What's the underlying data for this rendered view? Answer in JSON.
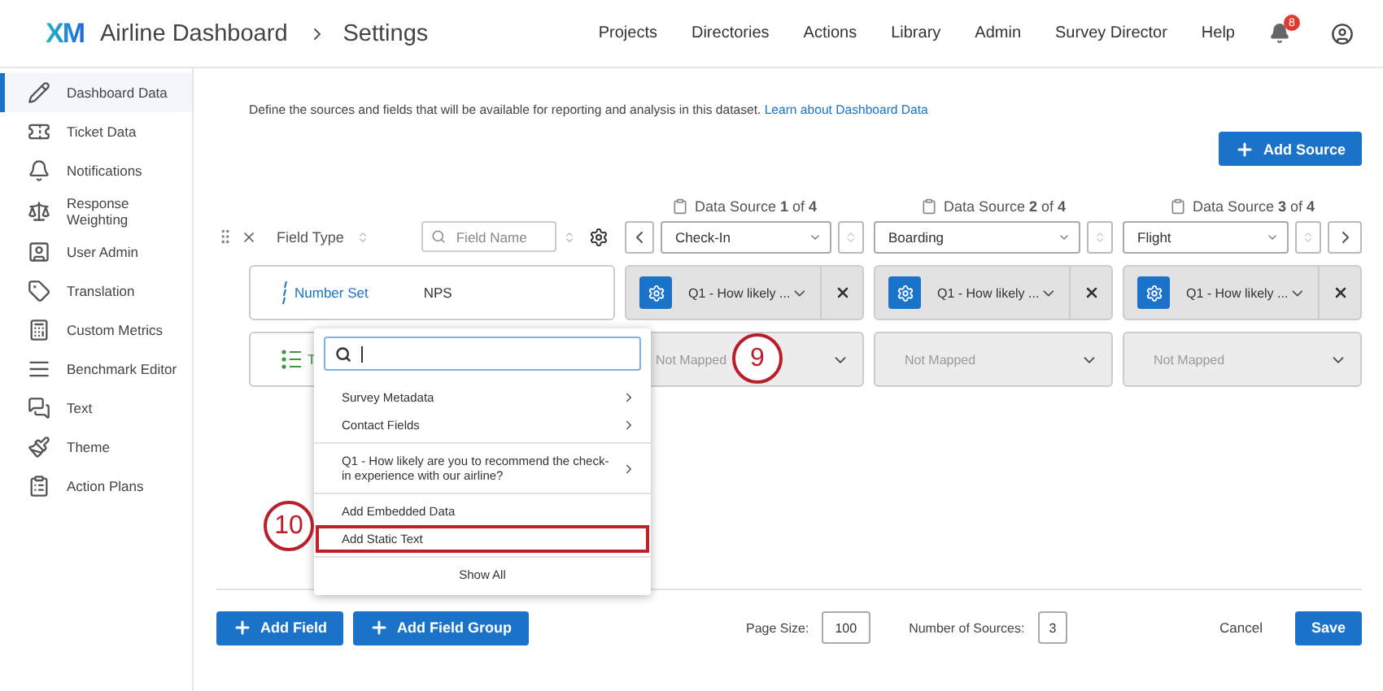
{
  "header": {
    "logo": "XM",
    "title": "Airline Dashboard",
    "breadcrumb": "Settings",
    "nav": [
      "Projects",
      "Directories",
      "Actions",
      "Library",
      "Admin",
      "Survey Director",
      "Help"
    ],
    "notification_count": "8"
  },
  "sidebar": {
    "items": [
      {
        "label": "Dashboard Data",
        "selected": true
      },
      {
        "label": "Ticket Data",
        "selected": false
      },
      {
        "label": "Notifications",
        "selected": false
      },
      {
        "label": "Response Weighting",
        "selected": false
      },
      {
        "label": "User Admin",
        "selected": false
      },
      {
        "label": "Translation",
        "selected": false
      },
      {
        "label": "Custom Metrics",
        "selected": false
      },
      {
        "label": "Benchmark Editor",
        "selected": false
      },
      {
        "label": "Text",
        "selected": false
      },
      {
        "label": "Theme",
        "selected": false
      },
      {
        "label": "Action Plans",
        "selected": false
      }
    ]
  },
  "description": {
    "text": "Define the sources and fields that will be available for reporting and analysis in this dataset.",
    "link": "Learn about Dashboard Data"
  },
  "add_source": "Add Source",
  "field_header": {
    "field_type": "Field Type",
    "field_name_placeholder": "Field Name"
  },
  "sources": [
    {
      "title": "Data Source **1** of **4**",
      "value": "Check-In"
    },
    {
      "title": "Data Source **2** of **4**",
      "value": "Boarding"
    },
    {
      "title": "Data Source **3** of **4**",
      "value": "Flight"
    }
  ],
  "fields": [
    {
      "kind": "number",
      "type_label": "Number Set",
      "name": "NPS",
      "mappings": [
        {
          "kind": "mapped",
          "text": "Q1 - How likely ..."
        },
        {
          "kind": "mapped",
          "text": "Q1 - How likely ..."
        },
        {
          "kind": "mapped",
          "text": "Q1 - How likely ..."
        }
      ]
    },
    {
      "kind": "text",
      "type_label": "T",
      "mappings": [
        {
          "kind": "unmapped",
          "text": "Not Mapped"
        },
        {
          "kind": "unmapped",
          "text": "Not Mapped"
        },
        {
          "kind": "unmapped",
          "text": "Not Mapped"
        }
      ]
    }
  ],
  "menu": {
    "sections": [
      [
        {
          "label": "Survey Metadata",
          "submenu": true,
          "highlighted": false
        },
        {
          "label": "Contact Fields",
          "submenu": true,
          "highlighted": false
        }
      ],
      [
        {
          "label": "Q1 - How likely are you to recommend the check-in experience with our airline?",
          "submenu": true,
          "highlighted": false
        }
      ],
      [
        {
          "label": "Add Embedded Data",
          "submenu": false,
          "highlighted": false
        },
        {
          "label": "Add Static Text",
          "submenu": false,
          "highlighted": true
        }
      ],
      [
        {
          "label": "Show All",
          "submenu": false,
          "highlighted": false
        }
      ]
    ]
  },
  "footer": {
    "add_field": "Add Field",
    "add_field_group": "Add Field Group",
    "page_size_label": "Page Size:",
    "page_size": "100",
    "sources_label": "Number of Sources:",
    "sources_count": "3",
    "cancel": "Cancel",
    "save": "Save"
  },
  "callouts": [
    "9",
    "10"
  ]
}
